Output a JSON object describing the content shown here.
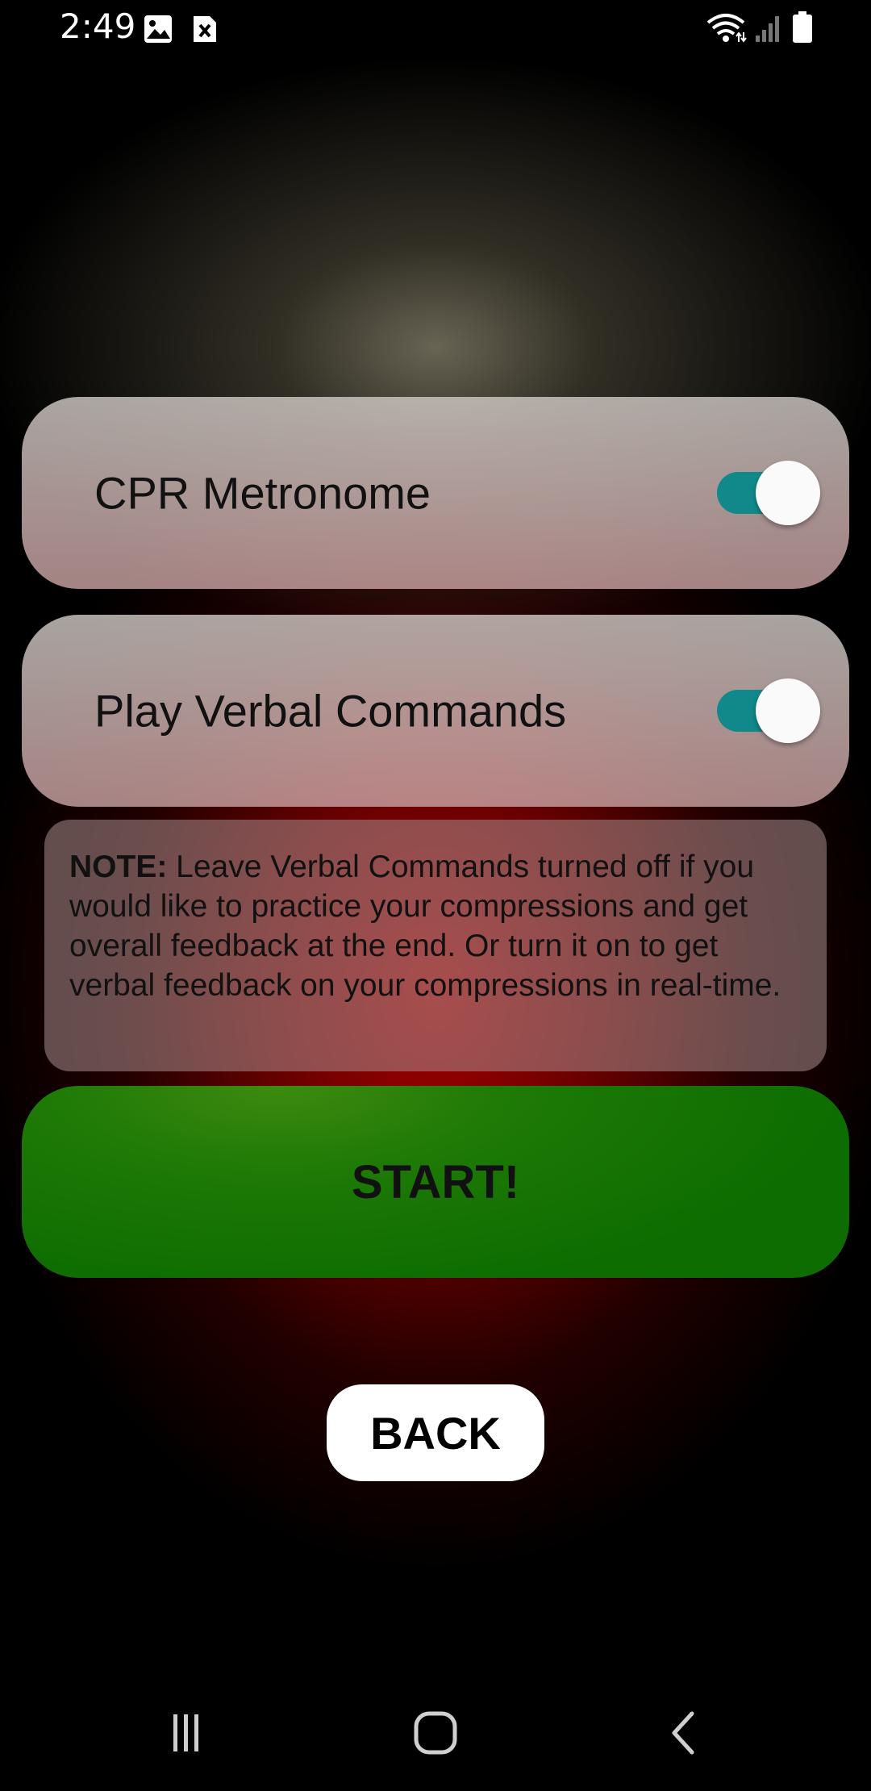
{
  "status_bar": {
    "time": "2:49",
    "icons": [
      "gallery-icon",
      "close-notification-icon",
      "wifi-icon",
      "signal-icon",
      "battery-icon"
    ]
  },
  "settings": {
    "metronome": {
      "label": "CPR Metronome",
      "enabled": true
    },
    "verbal": {
      "label": "Play Verbal Commands",
      "enabled": true
    }
  },
  "note": {
    "label": "NOTE:",
    "text": " Leave Verbal Commands turned off if you would like to practice your compressions and get overall feedback at the end. Or turn it on to get verbal feedback on your compressions in real-time."
  },
  "actions": {
    "start_label": "START!",
    "back_label": "BACK"
  },
  "colors": {
    "switch_track": "#11898a",
    "start_green": "#0d6d00",
    "background_red": "#af0000"
  },
  "nav_bar": {
    "icons": [
      "recent-apps-icon",
      "home-icon",
      "back-icon"
    ]
  }
}
